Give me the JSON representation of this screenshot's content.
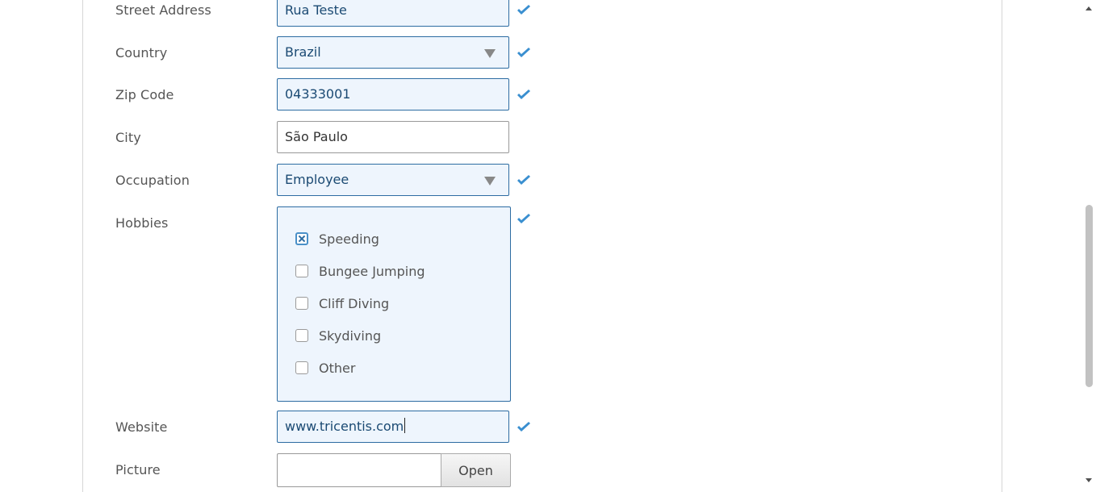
{
  "form": {
    "street_address": {
      "label": "Street Address",
      "value": "Rua Teste",
      "valid": true
    },
    "country": {
      "label": "Country",
      "value": "Brazil",
      "valid": true
    },
    "zip_code": {
      "label": "Zip Code",
      "value": "04333001",
      "valid": true
    },
    "city": {
      "label": "City",
      "value": "São Paulo",
      "valid": false
    },
    "occupation": {
      "label": "Occupation",
      "value": "Employee",
      "valid": true
    },
    "hobbies": {
      "label": "Hobbies",
      "options": [
        {
          "label": "Speeding",
          "checked": true
        },
        {
          "label": "Bungee Jumping",
          "checked": false
        },
        {
          "label": "Cliff Diving",
          "checked": false
        },
        {
          "label": "Skydiving",
          "checked": false
        },
        {
          "label": "Other",
          "checked": false
        }
      ]
    },
    "website": {
      "label": "Website",
      "value": "www.tricentis.com",
      "valid": true
    },
    "picture": {
      "label": "Picture",
      "value": "",
      "open_label": "Open"
    }
  },
  "colors": {
    "valid_border": "#2d6ca2",
    "valid_background": "#eef5fd",
    "check_mark": "#3a8fd0"
  },
  "icons": {
    "validation": "checkmark-icon",
    "dropdown": "triangle-down-icon",
    "checkbox_checked": "x-mark-icon"
  }
}
